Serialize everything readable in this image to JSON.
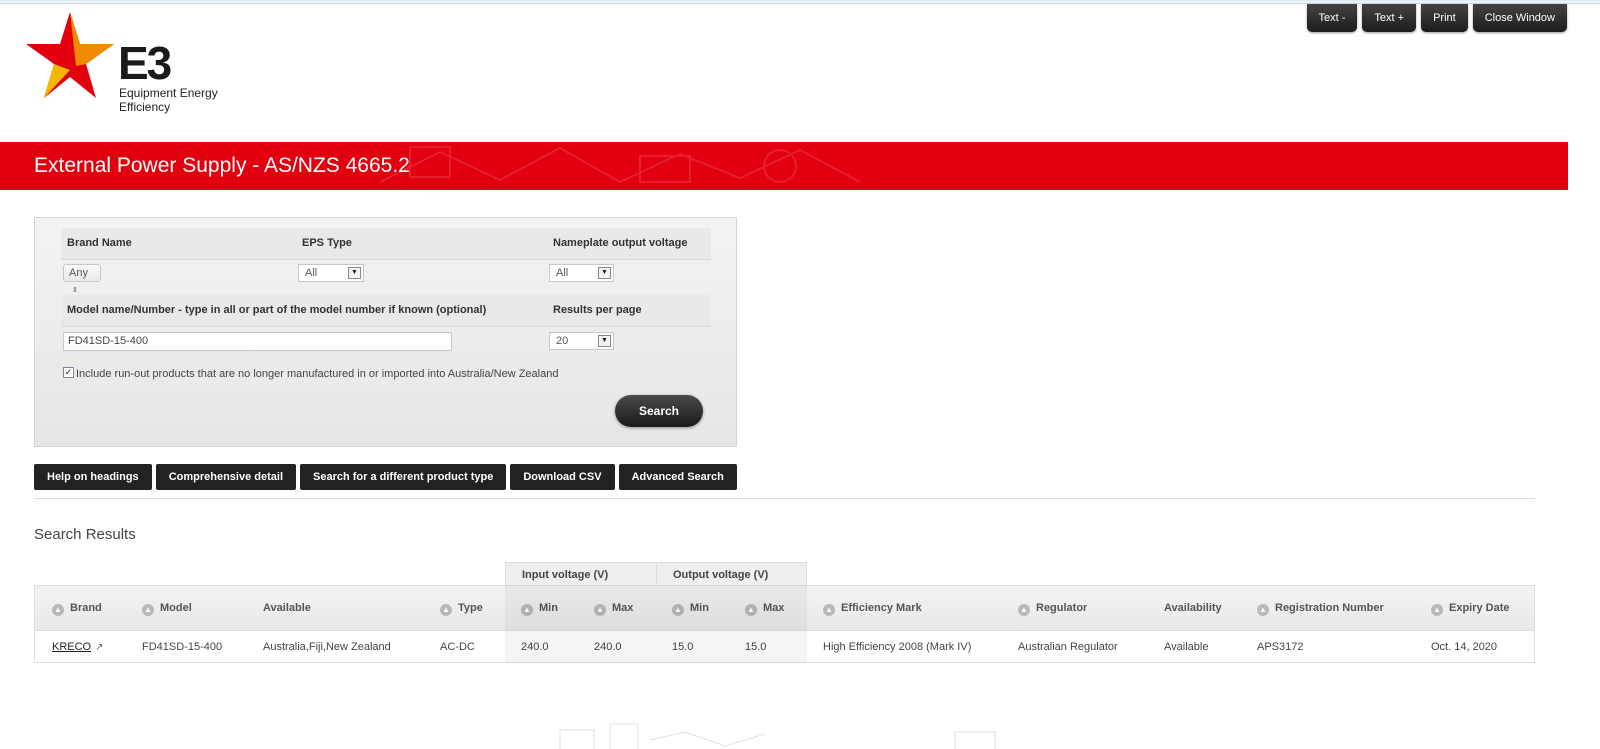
{
  "top_tools": [
    "Text -",
    "Text +",
    "Print",
    "Close Window"
  ],
  "logo": {
    "mark": "E3",
    "line1": "Equipment Energy",
    "line2": "Efficiency",
    "colors": {
      "red": "#e2000f",
      "yellow": "#f7b600"
    }
  },
  "page_title": "External Power Supply - AS/NZS 4665.2",
  "search_form": {
    "brand_label": "Brand Name",
    "brand_value": "Any",
    "eps_type_label": "EPS Type",
    "eps_type_value": "All",
    "voltage_label": "Nameplate output voltage",
    "voltage_value": "All",
    "model_label": "Model name/Number - type in all or part of the model number if known (optional)",
    "model_value": "FD41SD-15-400",
    "results_per_page_label": "Results per page",
    "results_per_page_value": "20",
    "runout_checked": true,
    "runout_label": "Include run-out products that are no longer manufactured in or imported into Australia/New Zealand",
    "search_button": "Search"
  },
  "actions": [
    "Help on headings",
    "Comprehensive detail",
    "Search for a different product type",
    "Download CSV",
    "Advanced Search"
  ],
  "results": {
    "title": "Search Results",
    "group_headers": {
      "input": "Input voltage (V)",
      "output": "Output voltage (V)"
    },
    "columns": {
      "brand": "Brand",
      "model": "Model",
      "available": "Available",
      "type": "Type",
      "in_min": "Min",
      "in_max": "Max",
      "out_min": "Min",
      "out_max": "Max",
      "efficiency": "Efficiency Mark",
      "regulator": "Regulator",
      "availability": "Availability",
      "registration": "Registration Number",
      "expiry": "Expiry Date"
    },
    "rows": [
      {
        "brand": "KRECO",
        "model": "FD41SD-15-400",
        "available": "Australia,Fiji,New Zealand",
        "type": "AC-DC",
        "in_min": "240.0",
        "in_max": "240.0",
        "out_min": "15.0",
        "out_max": "15.0",
        "efficiency": "High Efficiency 2008 (Mark IV)",
        "regulator": "Australian Regulator",
        "availability": "Available",
        "registration": "APS3172",
        "expiry": "Oct. 14, 2020"
      }
    ]
  }
}
